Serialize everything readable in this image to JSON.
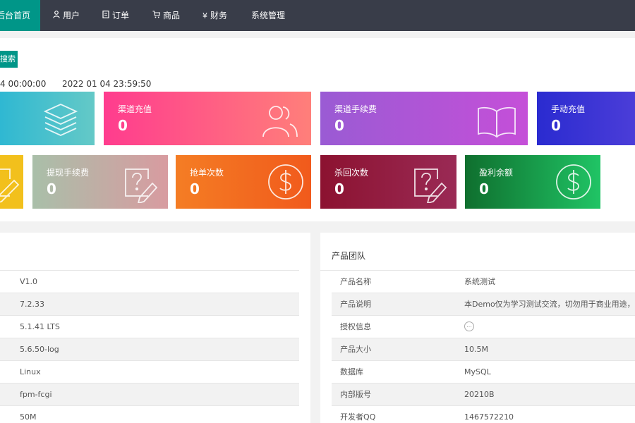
{
  "nav": {
    "items": [
      {
        "label": "后台首页",
        "icon": "home-icon",
        "active": true
      },
      {
        "label": "用户",
        "icon": "user-icon",
        "active": false
      },
      {
        "label": "订单",
        "icon": "file-icon",
        "active": false
      },
      {
        "label": "商品",
        "icon": "cart-icon",
        "active": false
      },
      {
        "label": "财务",
        "icon": "yen-icon",
        "glyph": "¥",
        "active": false
      },
      {
        "label": "系统管理",
        "icon": "",
        "active": false
      }
    ]
  },
  "filter": {
    "search_label": "搜索",
    "start_time": "4 00:00:00",
    "end_time": "2022 01 04 23:59:50"
  },
  "stats_row1": [
    {
      "label": "",
      "value": "",
      "icon": "layers-icon",
      "color": "#4bb9c9"
    },
    {
      "label": "渠道充值",
      "value": "0",
      "icon": "users-icon",
      "color": "#ff4f8f"
    },
    {
      "label": "渠道手续费",
      "value": "0",
      "icon": "book-icon",
      "color": "#a456d6"
    },
    {
      "label": "手动充值",
      "value": "0",
      "icon": "",
      "color": "#3c2fd6"
    }
  ],
  "stats_row2": [
    {
      "label": "",
      "value": "",
      "icon": "edit-icon",
      "color": "#f2c01c"
    },
    {
      "label": "提现手续费",
      "value": "0",
      "icon": "edit-question-icon",
      "color": "#a9a39c"
    },
    {
      "label": "抢单次数",
      "value": "0",
      "icon": "dollar-icon",
      "color": "#f26a1d"
    },
    {
      "label": "杀回次数",
      "value": "0",
      "icon": "edit-question-icon",
      "color": "#8a1637"
    },
    {
      "label": "盈利余额",
      "value": "0",
      "icon": "dollar-icon",
      "color": "#1fa84f"
    }
  ],
  "system_info": {
    "rows": [
      {
        "value": "V1.0"
      },
      {
        "value": "7.2.33"
      },
      {
        "value": "5.1.41 LTS"
      },
      {
        "value": "5.6.50-log"
      },
      {
        "value": "Linux"
      },
      {
        "value": "fpm-fcgi"
      },
      {
        "value": "50M"
      }
    ]
  },
  "product_team": {
    "title": "产品团队",
    "rows": [
      {
        "label": "产品名称",
        "value": "系统测试"
      },
      {
        "label": "产品说明",
        "value": "本Demo仅为学习测试交流，切勿用于商业用途，所带来的法律责任自行承担"
      },
      {
        "label": "授权信息",
        "value": "",
        "ring": "..."
      },
      {
        "label": "产品大小",
        "value": "10.5M"
      },
      {
        "label": "数据库",
        "value": "MySQL"
      },
      {
        "label": "内部版号",
        "value": "20210B"
      },
      {
        "label": "开发者QQ",
        "value": "1467572210"
      }
    ]
  }
}
